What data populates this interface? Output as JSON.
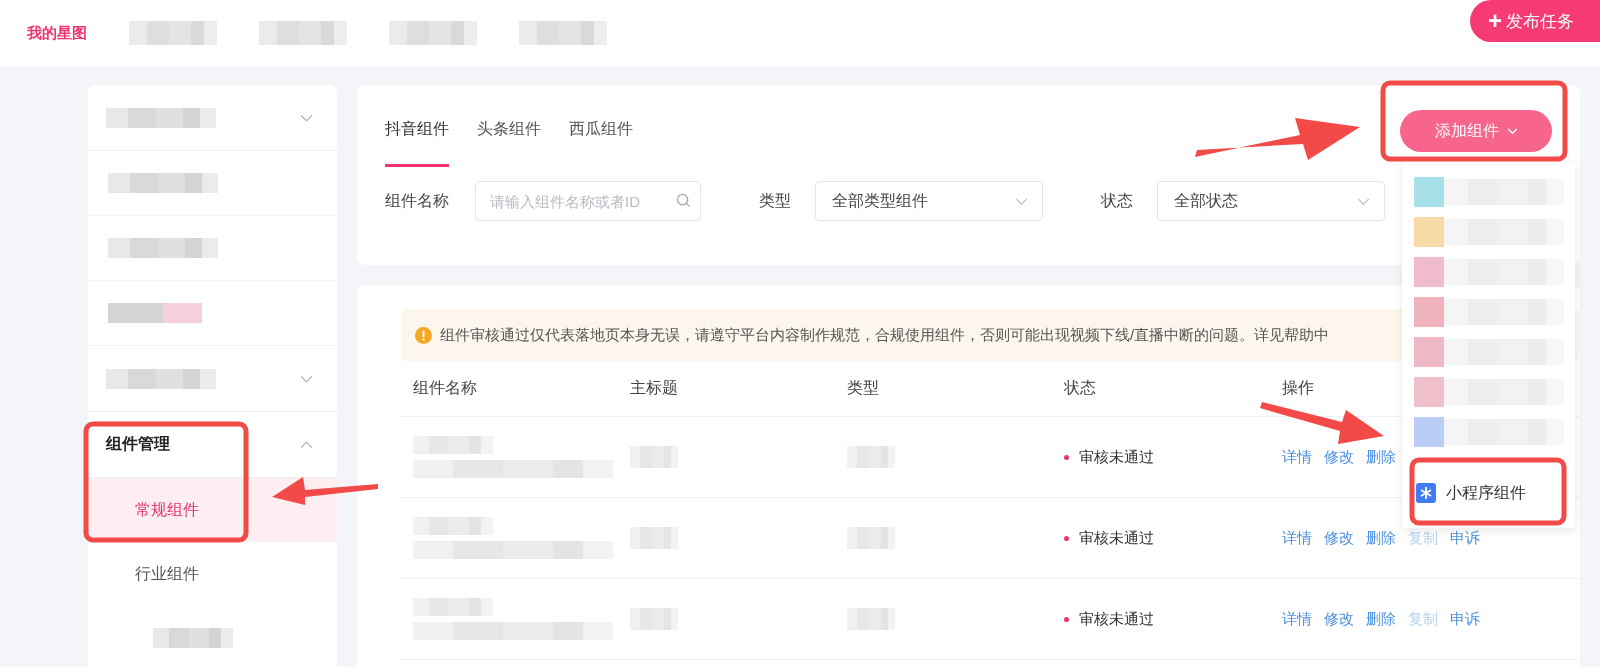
{
  "header": {
    "logo": "我的星图",
    "nav": [
      {
        "kind": "blurred"
      },
      {
        "kind": "blurred"
      },
      {
        "kind": "blurred"
      },
      {
        "kind": "blurred"
      }
    ],
    "publish_button": {
      "icon": "+",
      "label": "发布任务"
    }
  },
  "sidebar": {
    "items": [
      {
        "kind": "blurred-group",
        "expanded": false
      },
      {
        "kind": "blurred"
      },
      {
        "kind": "blurred"
      },
      {
        "kind": "blurred",
        "color": "#f2c4d0"
      },
      {
        "kind": "blurred-group",
        "expanded": false
      },
      {
        "kind": "group",
        "label": "组件管理",
        "expanded": true,
        "children": [
          {
            "kind": "item",
            "label": "常规组件",
            "selected": true
          },
          {
            "kind": "item",
            "label": "行业组件",
            "selected": false
          },
          {
            "kind": "blurred"
          }
        ]
      }
    ]
  },
  "tabs": [
    {
      "label": "抖音组件",
      "selected": true
    },
    {
      "label": "头条组件",
      "selected": false
    },
    {
      "label": "西瓜组件",
      "selected": false
    }
  ],
  "add_button": {
    "label": "添加组件"
  },
  "filters": {
    "name_label": "组件名称",
    "name_placeholder": "请输入组件名称或者ID",
    "type_label": "类型",
    "type_value": "全部类型组件",
    "status_label": "状态",
    "status_value": "全部状态"
  },
  "notice": "组件审核通过仅代表落地页本身无误，请遵守平台内容制作规范，合规使用组件，否则可能出现视频下线/直播中断的问题。详见帮助中",
  "table": {
    "columns": [
      "组件名称",
      "主标题",
      "类型",
      "状态",
      "操作"
    ],
    "rows": [
      {
        "status": "审核未通过",
        "actions": [
          {
            "label": "详情",
            "disabled": false
          },
          {
            "label": "修改",
            "disabled": false
          },
          {
            "label": "删除",
            "disabled": false
          }
        ]
      },
      {
        "status": "审核未通过",
        "actions": [
          {
            "label": "详情",
            "disabled": false
          },
          {
            "label": "修改",
            "disabled": false
          },
          {
            "label": "删除",
            "disabled": false
          },
          {
            "label": "复制",
            "disabled": true
          },
          {
            "label": "申诉",
            "disabled": false
          }
        ]
      },
      {
        "status": "审核未通过",
        "actions": [
          {
            "label": "详情",
            "disabled": false
          },
          {
            "label": "修改",
            "disabled": false
          },
          {
            "label": "删除",
            "disabled": false
          },
          {
            "label": "复制",
            "disabled": true
          },
          {
            "label": "申诉",
            "disabled": false
          }
        ]
      }
    ]
  },
  "dropdown": {
    "items": [
      {
        "kind": "blurred",
        "color": "#a8e0ea"
      },
      {
        "kind": "blurred",
        "color": "#f7d9a6"
      },
      {
        "kind": "blurred",
        "color": "#f0bccb"
      },
      {
        "kind": "blurred",
        "color": "#eeb3bd"
      },
      {
        "kind": "blurred",
        "color": "#eeb8c4"
      },
      {
        "kind": "blurred",
        "color": "#efc0cc"
      },
      {
        "kind": "blurred",
        "color": "#b9cdf7"
      },
      {
        "kind": "option",
        "label": "小程序组件"
      }
    ]
  }
}
